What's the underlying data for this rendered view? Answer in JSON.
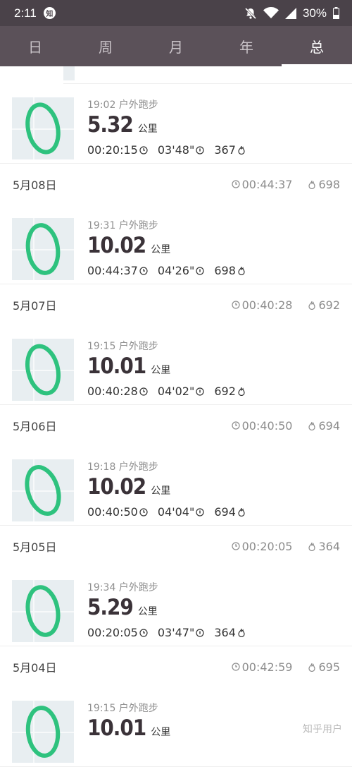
{
  "status_bar": {
    "time": "2:11",
    "app_badge": "知",
    "battery": "30%"
  },
  "tabs": [
    {
      "label": "日",
      "active": false
    },
    {
      "label": "周",
      "active": false
    },
    {
      "label": "月",
      "active": false
    },
    {
      "label": "年",
      "active": false
    },
    {
      "label": "总",
      "active": true
    }
  ],
  "colors": {
    "status_bar": "#4a4249",
    "tab_bar": "#5b5159",
    "track_green": "#2ec27e"
  },
  "icons": {
    "duration": "clock-icon",
    "pace": "pace-icon",
    "calories": "flame-icon"
  },
  "first_card": {
    "time_label": "19:02 户外跑步",
    "distance": "5.32",
    "unit": "公里",
    "duration": "00:20:15",
    "pace": "03'48\"",
    "calories": "367"
  },
  "days": [
    {
      "date": "5月08日",
      "total_duration": "00:44:37",
      "total_calories": "698",
      "run": {
        "time_label": "19:31 户外跑步",
        "distance": "10.02",
        "unit": "公里",
        "duration": "00:44:37",
        "pace": "04'26\"",
        "calories": "698"
      }
    },
    {
      "date": "5月07日",
      "total_duration": "00:40:28",
      "total_calories": "692",
      "run": {
        "time_label": "19:15 户外跑步",
        "distance": "10.01",
        "unit": "公里",
        "duration": "00:40:28",
        "pace": "04'02\"",
        "calories": "692"
      }
    },
    {
      "date": "5月06日",
      "total_duration": "00:40:50",
      "total_calories": "694",
      "run": {
        "time_label": "19:18 户外跑步",
        "distance": "10.02",
        "unit": "公里",
        "duration": "00:40:50",
        "pace": "04'04\"",
        "calories": "694"
      }
    },
    {
      "date": "5月05日",
      "total_duration": "00:20:05",
      "total_calories": "364",
      "run": {
        "time_label": "19:34 户外跑步",
        "distance": "5.29",
        "unit": "公里",
        "duration": "00:20:05",
        "pace": "03'47\"",
        "calories": "364"
      }
    },
    {
      "date": "5月04日",
      "total_duration": "00:42:59",
      "total_calories": "695",
      "run": {
        "time_label": "19:15 户外跑步",
        "distance": "10.01",
        "unit": "公里",
        "duration": "",
        "pace": "",
        "calories": ""
      }
    }
  ],
  "watermark": "知乎用户"
}
